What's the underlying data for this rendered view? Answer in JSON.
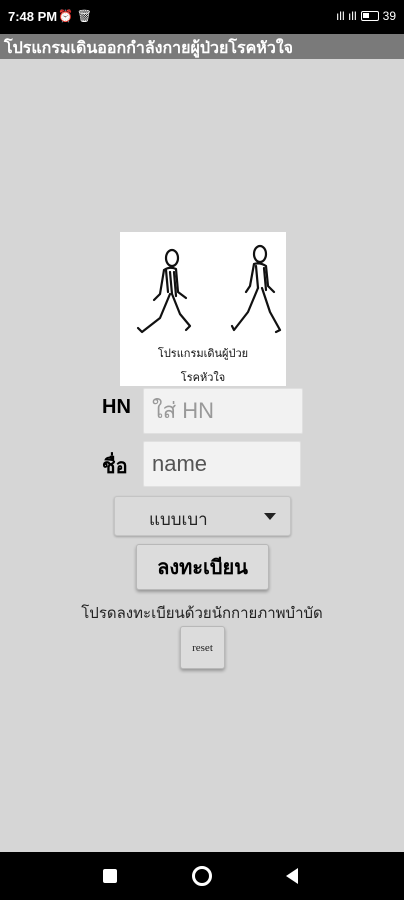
{
  "status_bar": {
    "time": "7:48 PM",
    "left_icons": "⏰ 🗑",
    "signal": "ıll ıll",
    "battery": "39"
  },
  "app": {
    "title": "โปรแกรมเดินออกกำลังกายผู้ป่วยโรคหัวใจ"
  },
  "logo": {
    "caption_line1": "โปรแกรมเดินผู้ป่วย",
    "caption_line2": "โรคหัวใจ",
    "icon": "walking-people-icon"
  },
  "form": {
    "hn_label": "HN",
    "hn_placeholder": "ใส่ HN",
    "name_label": "ชื่อ",
    "name_placeholder": "name",
    "level_selected": "แบบเบา",
    "register_label": "ลงทะเบียน",
    "hint": "โปรดลงทะเบียนด้วยนักกายภาพบำบัด",
    "reset_label": "reset"
  },
  "colors": {
    "background": "#d6d6d6",
    "title_bar": "#7a7a7a",
    "status_bar": "#000000"
  }
}
